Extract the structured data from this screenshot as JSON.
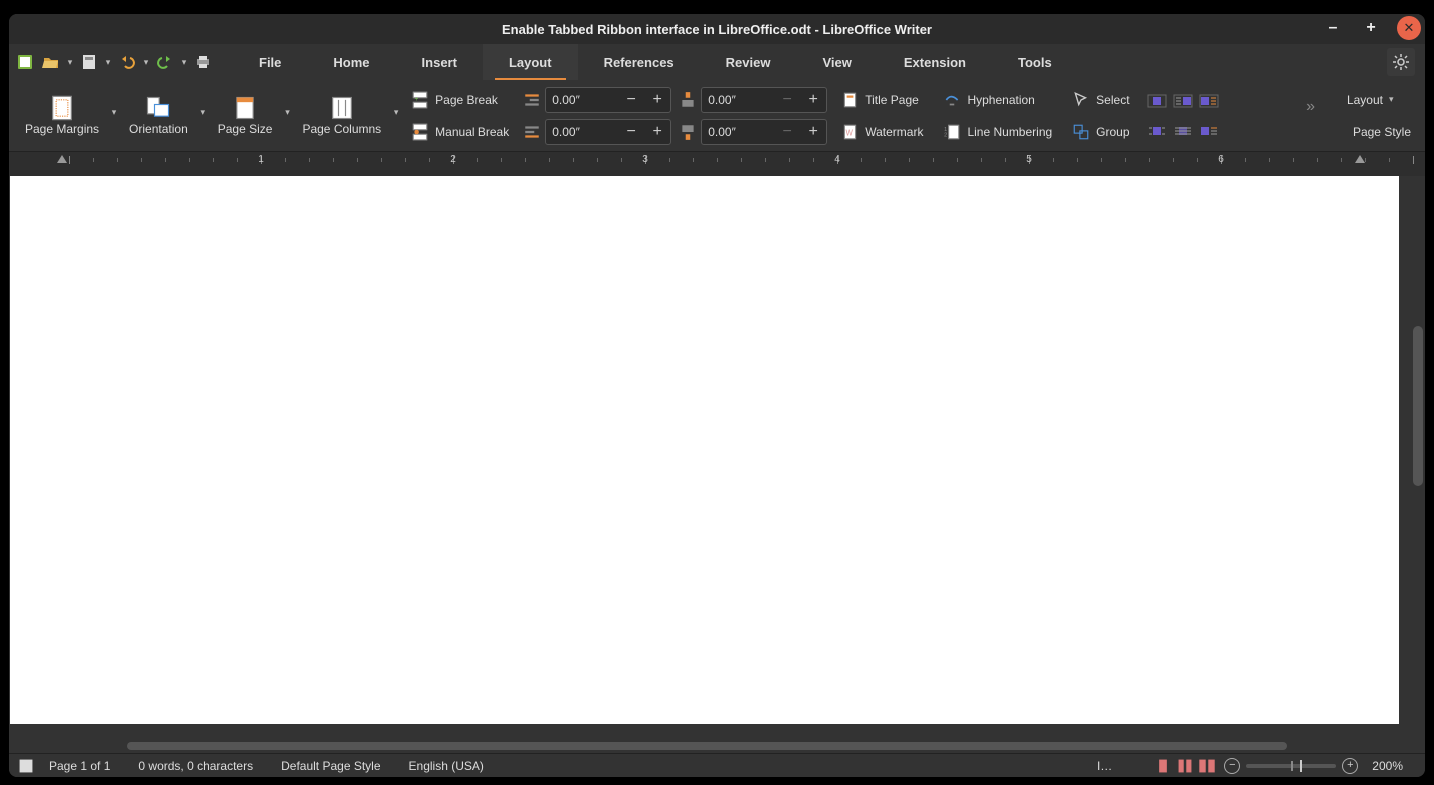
{
  "window_title": "Enable Tabbed Ribbon interface in LibreOffice.odt - LibreOffice Writer",
  "tabs": [
    "File",
    "Home",
    "Insert",
    "Layout",
    "References",
    "Review",
    "View",
    "Extension",
    "Tools"
  ],
  "active_tab": "Layout",
  "ribbon": {
    "page_margins": "Page Margins",
    "orientation": "Orientation",
    "page_size": "Page Size",
    "page_columns": "Page Columns",
    "page_break": "Page Break",
    "manual_break": "Manual Break",
    "indent_left": "0.00″",
    "indent_right": "0.00″",
    "spacing_before": "0.00″",
    "spacing_after": "0.00″",
    "title_page": "Title Page",
    "watermark": "Watermark",
    "hyphenation": "Hyphenation",
    "line_numbering": "Line Numbering",
    "select": "Select",
    "group": "Group",
    "layout_menu": "Layout",
    "page_style": "Page Style"
  },
  "ruler_numbers": [
    "1",
    "2",
    "3",
    "4",
    "5",
    "6"
  ],
  "status": {
    "page": "Page 1 of 1",
    "words": "0 words, 0 characters",
    "style": "Default Page Style",
    "lang": "English (USA)",
    "insert": "I…",
    "zoom": "200%"
  }
}
